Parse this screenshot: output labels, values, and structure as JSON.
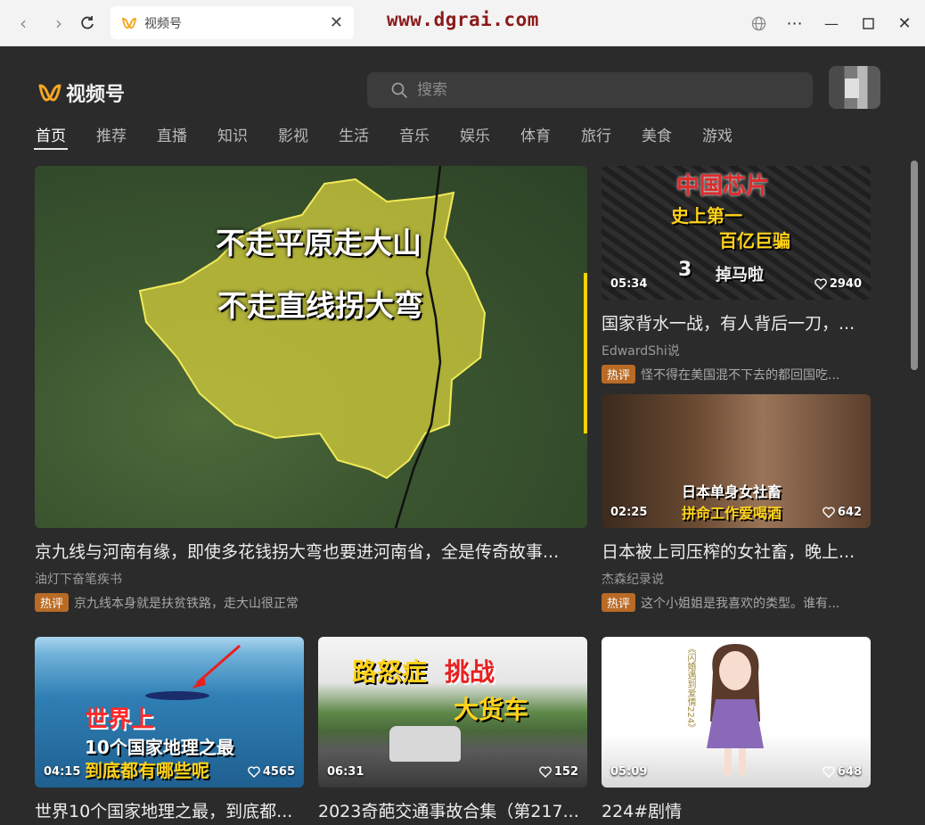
{
  "browser": {
    "tab_title": "视频号",
    "watermark": "www.dgrai.com",
    "nav_icons": [
      "back-icon",
      "forward-icon",
      "reload-icon",
      "close-icon",
      "globe-icon",
      "more-icon",
      "minimize-icon",
      "maximize-icon",
      "window-close-icon"
    ]
  },
  "app": {
    "logo_text": "视频号",
    "search": {
      "placeholder": "搜索"
    },
    "categories": [
      "首页",
      "推荐",
      "直播",
      "知识",
      "影视",
      "生活",
      "音乐",
      "娱乐",
      "体育",
      "旅行",
      "美食",
      "游戏"
    ],
    "active_category": "首页",
    "accent_color": "#f5a623"
  },
  "videos": [
    {
      "overlay_lines": [
        "不走平原走大山",
        "不走直线拐大弯"
      ],
      "title": "京九线与河南有缘，即使多花钱拐大弯也要进河南省，全是传奇故事...",
      "author": "油灯下奋笔疾书",
      "badge": "热评",
      "hot_comment": "京九线本身就是扶贫铁路，走大山很正常"
    },
    {
      "overlay_lines": [
        "中国芯片",
        "史上第一",
        "百亿巨骗",
        "3",
        "掉马啦"
      ],
      "duration": "05:34",
      "likes": "2940",
      "title": "国家背水一战，有人背后一刀，...",
      "author": "EdwardShi说",
      "badge": "热评",
      "hot_comment": "怪不得在美国混不下去的都回国吃..."
    },
    {
      "overlay_lines": [
        "日本单身女社畜",
        "拼命工作爱喝酒"
      ],
      "duration": "02:25",
      "likes": "642",
      "title": "日本被上司压榨的女社畜，晚上...",
      "author": "杰森纪录说",
      "badge": "热评",
      "hot_comment": "这个小姐姐是我喜欢的类型。谁有..."
    },
    {
      "overlay_lines": [
        "世界上",
        "10个国家地理之最",
        "到底都有哪些呢"
      ],
      "duration": "04:15",
      "likes": "4565",
      "title": "世界10个国家地理之最，到底都..."
    },
    {
      "overlay_lines": [
        "路怒症",
        "挑战",
        "大货车"
      ],
      "duration": "06:31",
      "likes": "152",
      "title": "2023奇葩交通事故合集（第217..."
    },
    {
      "overlay_lines": [
        "《闪婚遇到爱情224》"
      ],
      "duration": "05:09",
      "likes": "648",
      "title": "224#剧情"
    }
  ]
}
